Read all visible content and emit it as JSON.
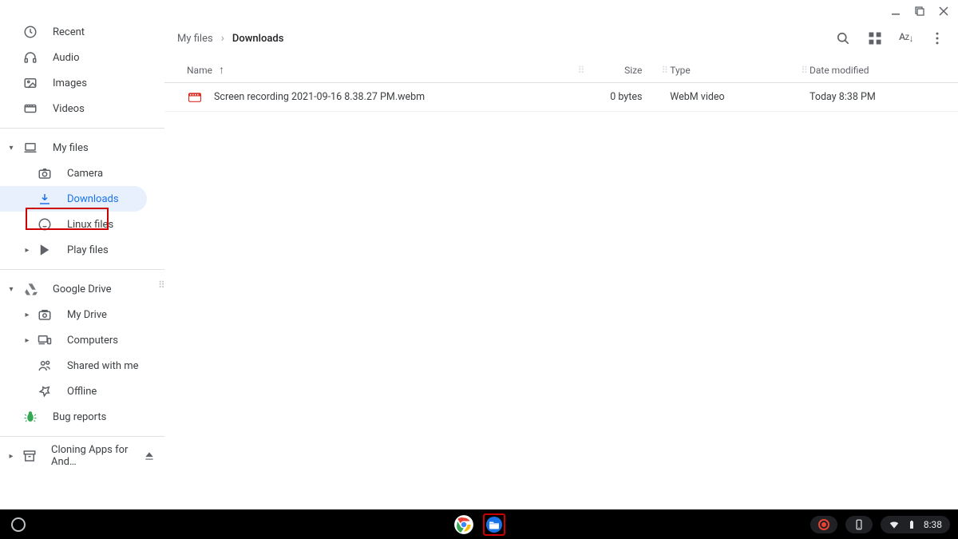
{
  "sidebar": {
    "quick": [
      {
        "label": "Recent",
        "icon": "clock"
      },
      {
        "label": "Audio",
        "icon": "headphones"
      },
      {
        "label": "Images",
        "icon": "image"
      },
      {
        "label": "Videos",
        "icon": "video"
      }
    ],
    "myfiles_label": "My files",
    "myfiles_children": [
      {
        "label": "Camera",
        "icon": "camera"
      },
      {
        "label": "Downloads",
        "icon": "download"
      },
      {
        "label": "Linux files",
        "icon": "linux"
      },
      {
        "label": "Play files",
        "icon": "play"
      }
    ],
    "drive_label": "Google Drive",
    "drive_children": [
      {
        "label": "My Drive",
        "icon": "drive-folder"
      },
      {
        "label": "Computers",
        "icon": "devices"
      },
      {
        "label": "Shared with me",
        "icon": "people"
      },
      {
        "label": "Offline",
        "icon": "pin"
      }
    ],
    "bug_label": "Bug reports",
    "cloning_label": "Cloning Apps for And…"
  },
  "breadcrumb": {
    "root": "My files",
    "current": "Downloads"
  },
  "columns": {
    "name": "Name",
    "size": "Size",
    "type": "Type",
    "date": "Date modified"
  },
  "files": [
    {
      "name": "Screen recording 2021-09-16 8.38.27 PM.webm",
      "size": "0 bytes",
      "type": "WebM video",
      "date": "Today 8:38 PM"
    }
  ],
  "shelf": {
    "clock": "8:38"
  }
}
